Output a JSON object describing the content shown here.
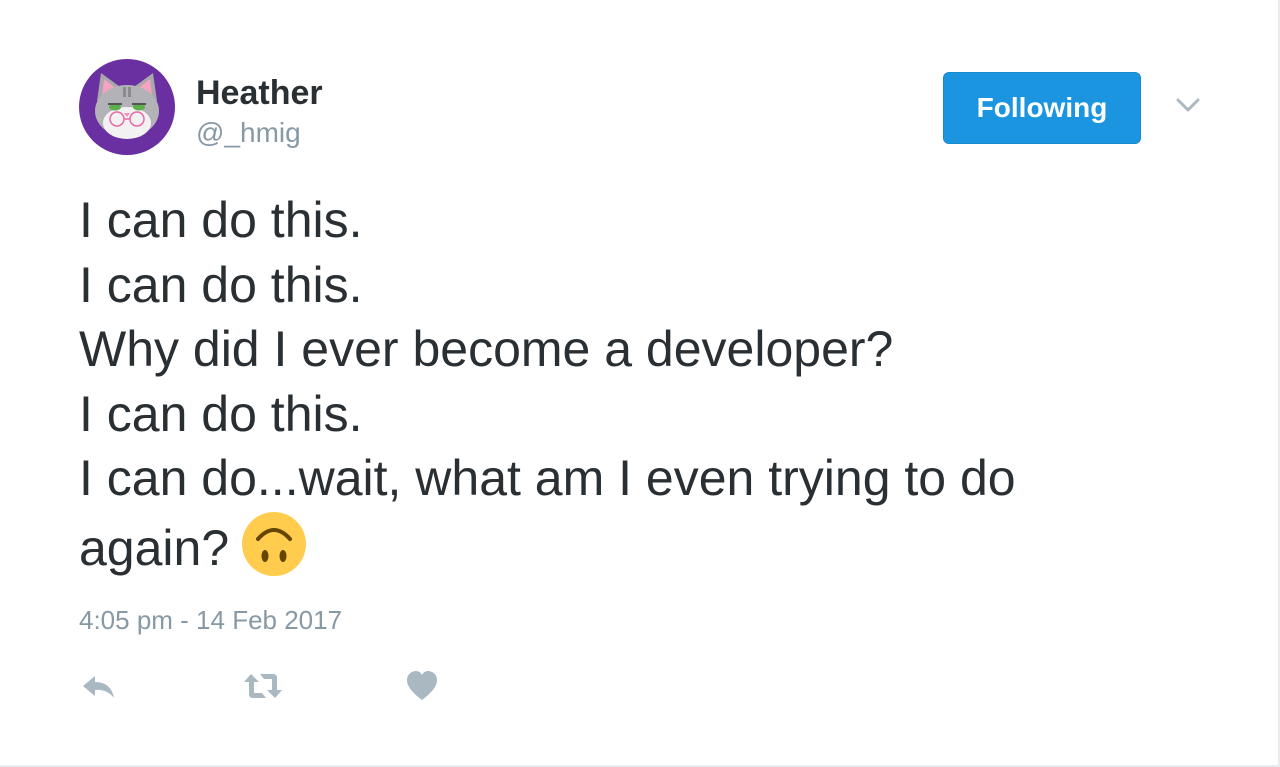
{
  "tweet": {
    "author": {
      "name": "Heather",
      "handle": "@_hmig"
    },
    "follow_button_label": "Following",
    "text_lines": [
      "I can do this.",
      "I can do this.",
      "Why did I ever become a developer?",
      "I can do this.",
      "I can do...wait, what am I even trying to do",
      "again?"
    ],
    "trailing_emoji": "upside-down-face",
    "timestamp": "4:05 pm - 14 Feb 2017",
    "actions": [
      "reply-icon",
      "retweet-icon",
      "like-icon"
    ]
  },
  "colors": {
    "follow_button": "#1b95e0",
    "avatar_background": "#6a2fa0",
    "secondary_text": "#8899a6",
    "primary_text": "#292f33",
    "emoji": "#ffcc4d"
  }
}
